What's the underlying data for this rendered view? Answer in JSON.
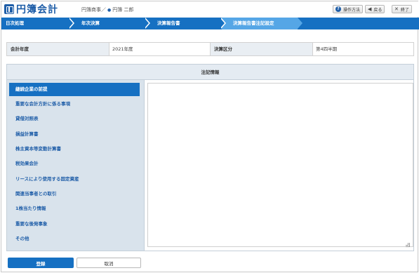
{
  "app": {
    "logo_text": "円簿会計",
    "company": "円簿商事",
    "separator": "／",
    "user": "円簿 二郎"
  },
  "header_buttons": {
    "help": "操作方法",
    "back": "戻る",
    "exit": "終了"
  },
  "breadcrumb": [
    {
      "label": "日次処理"
    },
    {
      "label": "年次決算"
    },
    {
      "label": "決算報告書"
    },
    {
      "label": "決算報告書注記設定"
    }
  ],
  "form": {
    "fiscal_year_label": "会計年度",
    "fiscal_year_value": "2021年度",
    "period_label": "決算区分",
    "period_value": "第4四半期"
  },
  "notes": {
    "title": "注記情報",
    "items": [
      {
        "label": "継続企業の前提"
      },
      {
        "label": "重要な会計方針に係る事項"
      },
      {
        "label": "貸借対照表"
      },
      {
        "label": "損益計算書"
      },
      {
        "label": "株主資本等変動計算書"
      },
      {
        "label": "税効果会計"
      },
      {
        "label": "リースにより使用する固定資産"
      },
      {
        "label": "関連当事者との取引"
      },
      {
        "label": "1株当たり情報"
      },
      {
        "label": "重要な後発事象"
      },
      {
        "label": "その他"
      }
    ],
    "active_index": 0,
    "text_value": ""
  },
  "actions": {
    "register": "登録",
    "cancel": "取消"
  },
  "colors": {
    "primary": "#1670c2",
    "active_step": "#55a6e6",
    "link": "#1f5ea8"
  }
}
